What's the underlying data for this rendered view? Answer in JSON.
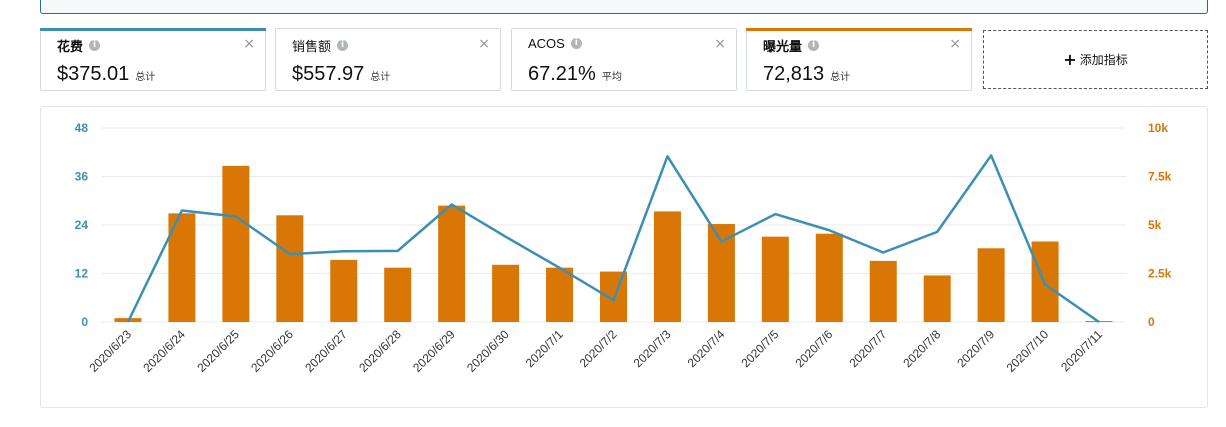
{
  "metrics": [
    {
      "title": "花费",
      "value": "$375.01",
      "suffix": "总计",
      "bar_color": "#3b8fb5",
      "bold": true
    },
    {
      "title": "销售额",
      "value": "$557.97",
      "suffix": "总计",
      "bar_color": "",
      "bold": false
    },
    {
      "title": "ACOS",
      "value": "67.21%",
      "suffix": "平均",
      "bar_color": "",
      "bold": false
    },
    {
      "title": "曝光量",
      "value": "72,813",
      "suffix": "总计",
      "bar_color": "#d97706",
      "bold": true
    }
  ],
  "add_metric_label": "添加指标",
  "icons": {
    "info": "info-icon",
    "close": "close-icon",
    "plus": "plus-icon"
  },
  "chart_data": {
    "type": "bar+line",
    "categories": [
      "2020/6/23",
      "2020/6/24",
      "2020/6/25",
      "2020/6/26",
      "2020/6/27",
      "2020/6/28",
      "2020/6/29",
      "2020/6/30",
      "2020/7/1",
      "2020/7/2",
      "2020/7/3",
      "2020/7/4",
      "2020/7/5",
      "2020/7/6",
      "2020/7/7",
      "2020/7/8",
      "2020/7/9",
      "2020/7/10",
      "2020/7/11"
    ],
    "series": [
      {
        "name": "花费",
        "type": "line",
        "axis": "left",
        "color": "#3b8fb5",
        "values": [
          0,
          27.6,
          26.1,
          16.8,
          17.5,
          17.6,
          29.1,
          21.1,
          13.4,
          5.4,
          41.0,
          19.9,
          26.7,
          22.7,
          17.2,
          22.3,
          41.2,
          9.3,
          0
        ]
      },
      {
        "name": "曝光量",
        "type": "bar",
        "axis": "right",
        "color": "#d97706",
        "values": [
          200,
          5600,
          8050,
          5500,
          3200,
          2800,
          6000,
          2950,
          2800,
          2600,
          5700,
          5050,
          4400,
          4550,
          3150,
          2400,
          3800,
          4150,
          50
        ]
      }
    ],
    "y_left": {
      "ticks": [
        "0",
        "12",
        "24",
        "36",
        "48"
      ],
      "lim": [
        0,
        48
      ]
    },
    "y_right": {
      "ticks": [
        "0",
        "2.5k",
        "5k",
        "7.5k",
        "10k"
      ],
      "lim": [
        0,
        10000
      ]
    },
    "grid": true,
    "legend": "none"
  }
}
